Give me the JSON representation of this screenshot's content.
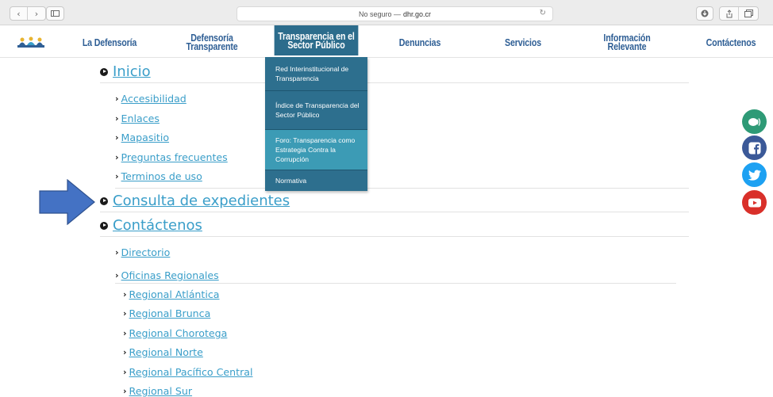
{
  "browser": {
    "url_prefix": "No seguro —",
    "url_domain": "dhr.go.cr"
  },
  "nav": {
    "items": [
      {
        "label": "La Defensoría"
      },
      {
        "label": "Defensoría Transparente"
      },
      {
        "label": "Transparencia en el Sector Público"
      },
      {
        "label": "Denuncias"
      },
      {
        "label": "Servicios"
      },
      {
        "label": "Información Relevante"
      },
      {
        "label": "Contáctenos"
      }
    ]
  },
  "dropdown": {
    "items": [
      {
        "label": "Red Interinstitucional de Transparencia"
      },
      {
        "label": "Índice de Transparencia del Sector Público"
      },
      {
        "label": "Foro: Transparencia como Estrategia Contra la Corrupción"
      },
      {
        "label": "Normativa"
      }
    ]
  },
  "sitemap": {
    "inicio": {
      "label": "Inicio"
    },
    "inicio_links": [
      {
        "label": "Accesibilidad"
      },
      {
        "label": "Enlaces"
      },
      {
        "label": "Mapasitio"
      },
      {
        "label": "Preguntas frecuentes"
      },
      {
        "label": "Terminos de uso"
      }
    ],
    "consulta": {
      "label": "Consulta de expedientes"
    },
    "contactenos": {
      "label": "Contáctenos"
    },
    "contact_links": [
      {
        "label": "Directorio"
      },
      {
        "label": "Oficinas Regionales"
      }
    ],
    "regional_links": [
      {
        "label": "Regional Atlántica"
      },
      {
        "label": "Regional Brunca"
      },
      {
        "label": "Regional Chorotega"
      },
      {
        "label": "Regional Norte"
      },
      {
        "label": "Regional Pacífico Central"
      },
      {
        "label": "Regional Sur"
      }
    ]
  },
  "colors": {
    "link": "#3a9ec9",
    "nav_text": "#2f5f95",
    "dropdown_bg": "#2d6f8e",
    "dropdown_highlight": "#3c9bb5",
    "arrow": "#4472c4",
    "chat_icon": "#2e9a76",
    "facebook_icon": "#3b5998",
    "twitter_icon": "#1da1f2",
    "youtube_icon": "#d9302a"
  },
  "social": {
    "icons": [
      "chat-icon",
      "facebook-icon",
      "twitter-icon",
      "youtube-icon"
    ]
  }
}
